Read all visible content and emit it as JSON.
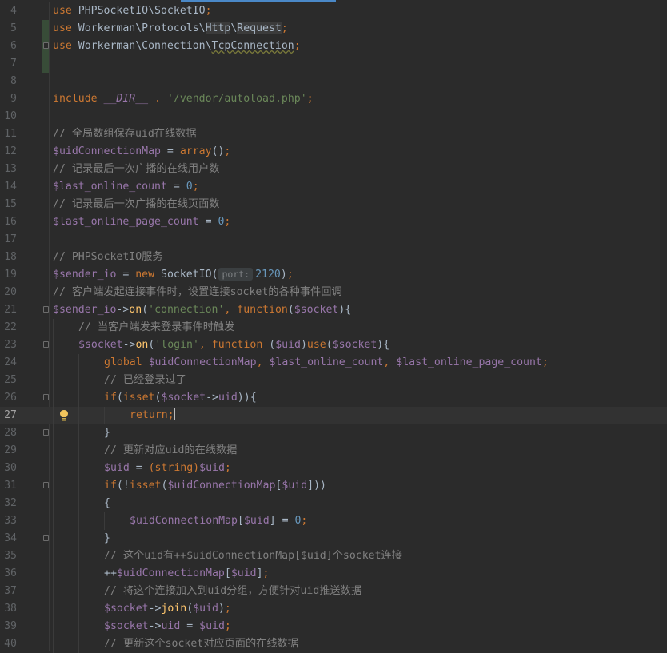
{
  "editor": {
    "current_line": 27,
    "changed_lines": [
      5,
      6,
      7
    ],
    "colors": {
      "background": "#2b2b2b",
      "keyword": "#cc7832",
      "variable": "#9876aa",
      "string": "#6a8759",
      "number": "#6897bb",
      "function": "#ffc66d",
      "comment": "#808080",
      "current_line": "#323232",
      "changed_marker": "#384c38"
    },
    "icons": {
      "bulb": "lightbulb-icon",
      "fold": "fold-marker-icon"
    },
    "lines": [
      {
        "n": 4,
        "indent": 0,
        "tokens": [
          [
            "kw",
            "use"
          ],
          [
            "",
            "PHPSocketIO\\SocketIO"
          ],
          [
            "kw",
            ";"
          ]
        ]
      },
      {
        "n": 5,
        "indent": 0,
        "tokens": [
          [
            "kw",
            "use"
          ],
          [
            "",
            "Workerman\\Protocols\\"
          ],
          [
            "hl",
            "Http"
          ],
          [
            "",
            "\\"
          ],
          [
            "hl",
            "Request"
          ],
          [
            "kw",
            ";"
          ]
        ]
      },
      {
        "n": 6,
        "indent": 0,
        "fold": true,
        "tokens": [
          [
            "kw",
            "use"
          ],
          [
            "",
            "Workerman\\Connection\\"
          ],
          [
            "sq",
            "TcpConnection"
          ],
          [
            "kw",
            ";"
          ]
        ]
      },
      {
        "n": 7,
        "indent": 0,
        "tokens": []
      },
      {
        "n": 8,
        "indent": 0,
        "tokens": []
      },
      {
        "n": 9,
        "indent": 0,
        "tokens": [
          [
            "kw",
            "include"
          ],
          [
            "cn",
            "__DIR__"
          ],
          [
            "kw",
            "."
          ],
          [
            "str",
            "'/vendor/autoload.php'"
          ],
          [
            "kw",
            ";"
          ]
        ]
      },
      {
        "n": 10,
        "indent": 0,
        "tokens": []
      },
      {
        "n": 11,
        "indent": 0,
        "tokens": [
          [
            "cm",
            "// 全局数组保存uid在线数据"
          ]
        ]
      },
      {
        "n": 12,
        "indent": 0,
        "tokens": [
          [
            "var",
            "$uidConnectionMap"
          ],
          [
            "",
            " = "
          ],
          [
            "kw",
            "array"
          ],
          [
            "",
            "()"
          ],
          [
            "kw",
            ";"
          ]
        ]
      },
      {
        "n": 13,
        "indent": 0,
        "tokens": [
          [
            "cm",
            "// 记录最后一次广播的在线用户数"
          ]
        ]
      },
      {
        "n": 14,
        "indent": 0,
        "tokens": [
          [
            "var",
            "$last_online_count"
          ],
          [
            "",
            " = "
          ],
          [
            "num",
            "0"
          ],
          [
            "kw",
            ";"
          ]
        ]
      },
      {
        "n": 15,
        "indent": 0,
        "tokens": [
          [
            "cm",
            "// 记录最后一次广播的在线页面数"
          ]
        ]
      },
      {
        "n": 16,
        "indent": 0,
        "tokens": [
          [
            "var",
            "$last_online_page_count"
          ],
          [
            "",
            " = "
          ],
          [
            "num",
            "0"
          ],
          [
            "kw",
            ";"
          ]
        ]
      },
      {
        "n": 17,
        "indent": 0,
        "tokens": []
      },
      {
        "n": 18,
        "indent": 0,
        "tokens": [
          [
            "cm",
            "// PHPSocketIO服务"
          ]
        ]
      },
      {
        "n": 19,
        "indent": 0,
        "tokens": [
          [
            "var",
            "$sender_io"
          ],
          [
            "",
            " = "
          ],
          [
            "kw",
            "new"
          ],
          [
            "",
            " SocketIO("
          ],
          [
            "hint",
            "port:"
          ],
          [
            "num",
            "2120"
          ],
          [
            "",
            ")"
          ],
          [
            "kw",
            ";"
          ]
        ]
      },
      {
        "n": 20,
        "indent": 0,
        "tokens": [
          [
            "cm",
            "// 客户端发起连接事件时，设置连接socket的各种事件回调"
          ]
        ]
      },
      {
        "n": 21,
        "indent": 0,
        "fold": true,
        "tokens": [
          [
            "var",
            "$sender_io"
          ],
          [
            "",
            "->"
          ],
          [
            "fn",
            "on"
          ],
          [
            "",
            "("
          ],
          [
            "str",
            "'connection'"
          ],
          [
            "kw",
            ", function"
          ],
          [
            "",
            "("
          ],
          [
            "var",
            "$socket"
          ],
          [
            "",
            "){"
          ]
        ]
      },
      {
        "n": 22,
        "indent": 1,
        "tokens": [
          [
            "cm",
            "// 当客户端发来登录事件时触发"
          ]
        ]
      },
      {
        "n": 23,
        "indent": 1,
        "fold": true,
        "tokens": [
          [
            "var",
            "$socket"
          ],
          [
            "",
            "->"
          ],
          [
            "fn",
            "on"
          ],
          [
            "",
            "("
          ],
          [
            "str",
            "'login'"
          ],
          [
            "kw",
            ", function "
          ],
          [
            "",
            "("
          ],
          [
            "var",
            "$uid"
          ],
          [
            "",
            ")"
          ],
          [
            "kw",
            "use"
          ],
          [
            "",
            "("
          ],
          [
            "var",
            "$socket"
          ],
          [
            "",
            "){"
          ]
        ]
      },
      {
        "n": 24,
        "indent": 2,
        "tokens": [
          [
            "kw",
            "global "
          ],
          [
            "var",
            "$uidConnectionMap"
          ],
          [
            "kw",
            ", "
          ],
          [
            "var",
            "$last_online_count"
          ],
          [
            "kw",
            ", "
          ],
          [
            "var",
            "$last_online_page_count"
          ],
          [
            "kw",
            ";"
          ]
        ]
      },
      {
        "n": 25,
        "indent": 2,
        "tokens": [
          [
            "cm",
            "// 已经登录过了"
          ]
        ]
      },
      {
        "n": 26,
        "indent": 2,
        "fold": true,
        "tokens": [
          [
            "kw",
            "if"
          ],
          [
            "",
            "("
          ],
          [
            "kw",
            "isset"
          ],
          [
            "",
            "("
          ],
          [
            "var",
            "$socket"
          ],
          [
            "",
            "->"
          ],
          [
            "var",
            "uid"
          ],
          [
            "",
            "))"
          ],
          [
            "",
            "{"
          ]
        ]
      },
      {
        "n": 27,
        "indent": 3,
        "bulb": true,
        "caret": true,
        "tokens": [
          [
            "kw",
            "return;"
          ]
        ]
      },
      {
        "n": 28,
        "indent": 2,
        "fold": true,
        "tokens": [
          [
            "",
            "}"
          ]
        ]
      },
      {
        "n": 29,
        "indent": 2,
        "tokens": [
          [
            "cm",
            "// 更新对应uid的在线数据"
          ]
        ]
      },
      {
        "n": 30,
        "indent": 2,
        "tokens": [
          [
            "var",
            "$uid"
          ],
          [
            "",
            " = "
          ],
          [
            "kw",
            "(string)"
          ],
          [
            "var",
            "$uid"
          ],
          [
            "kw",
            ";"
          ]
        ]
      },
      {
        "n": 31,
        "indent": 2,
        "fold": true,
        "tokens": [
          [
            "kw",
            "if"
          ],
          [
            "",
            "(!"
          ],
          [
            "kw",
            "isset"
          ],
          [
            "",
            "("
          ],
          [
            "var",
            "$uidConnectionMap"
          ],
          [
            "",
            "["
          ],
          [
            "var",
            "$uid"
          ],
          [
            "",
            "]))"
          ]
        ]
      },
      {
        "n": 32,
        "indent": 2,
        "tokens": [
          [
            "",
            "{"
          ]
        ]
      },
      {
        "n": 33,
        "indent": 3,
        "tokens": [
          [
            "var",
            "$uidConnectionMap"
          ],
          [
            "",
            "["
          ],
          [
            "var",
            "$uid"
          ],
          [
            "",
            "] = "
          ],
          [
            "num",
            "0"
          ],
          [
            "kw",
            ";"
          ]
        ]
      },
      {
        "n": 34,
        "indent": 2,
        "fold": true,
        "tokens": [
          [
            "",
            "}"
          ]
        ]
      },
      {
        "n": 35,
        "indent": 2,
        "tokens": [
          [
            "cm",
            "// 这个uid有++$uidConnectionMap[$uid]个socket连接"
          ]
        ]
      },
      {
        "n": 36,
        "indent": 2,
        "tokens": [
          [
            "",
            "++"
          ],
          [
            "var",
            "$uidConnectionMap"
          ],
          [
            "",
            "["
          ],
          [
            "var",
            "$uid"
          ],
          [
            "",
            "]"
          ],
          [
            "kw",
            ";"
          ]
        ]
      },
      {
        "n": 37,
        "indent": 2,
        "tokens": [
          [
            "cm",
            "// 将这个连接加入到uid分组，方便针对uid推送数据"
          ]
        ]
      },
      {
        "n": 38,
        "indent": 2,
        "tokens": [
          [
            "var",
            "$socket"
          ],
          [
            "",
            "->"
          ],
          [
            "fn",
            "join"
          ],
          [
            "",
            "("
          ],
          [
            "var",
            "$uid"
          ],
          [
            "",
            ")"
          ],
          [
            "kw",
            ";"
          ]
        ]
      },
      {
        "n": 39,
        "indent": 2,
        "tokens": [
          [
            "var",
            "$socket"
          ],
          [
            "",
            "->"
          ],
          [
            "var",
            "uid"
          ],
          [
            "",
            " = "
          ],
          [
            "var",
            "$uid"
          ],
          [
            "kw",
            ";"
          ]
        ]
      },
      {
        "n": 40,
        "indent": 2,
        "tokens": [
          [
            "cm",
            "// 更新这个socket对应页面的在线数据"
          ]
        ]
      }
    ]
  }
}
